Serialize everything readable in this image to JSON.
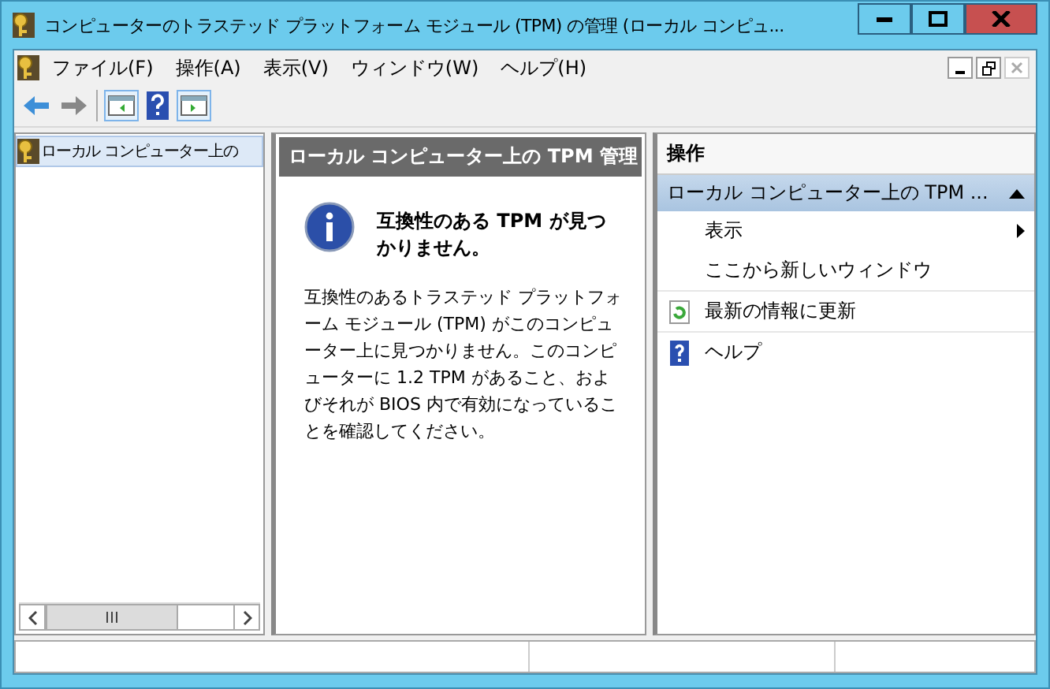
{
  "window": {
    "title": "コンピューターのトラステッド プラットフォーム モジュール (TPM) の管理 (ローカル コンピュ..."
  },
  "menu": [
    "ファイル(F)",
    "操作(A)",
    "表示(V)",
    "ウィンドウ(W)",
    "ヘルプ(H)"
  ],
  "tree": {
    "items": [
      {
        "label": "ローカル コンピューター上の",
        "selected": true
      }
    ]
  },
  "center": {
    "header": "ローカル コンピューター上の TPM 管理",
    "message_title": "互換性のある TPM が見つかりません。",
    "message_body": "互換性のあるトラステッド プラットフォーム モジュール (TPM) がこのコンピューター上に見つかりません。このコンピューターに 1.2 TPM があること、およびそれが BIOS 内で有効になっていることを確認してください。"
  },
  "actions": {
    "header": "操作",
    "group_title": "ローカル コンピューター上の TPM ...",
    "items": [
      {
        "label": "表示",
        "kind": "submenu"
      },
      {
        "label": "ここから新しいウィンドウ",
        "kind": "plain"
      },
      {
        "label": "最新の情報に更新",
        "kind": "refresh"
      },
      {
        "label": "ヘルプ",
        "kind": "help"
      }
    ]
  }
}
